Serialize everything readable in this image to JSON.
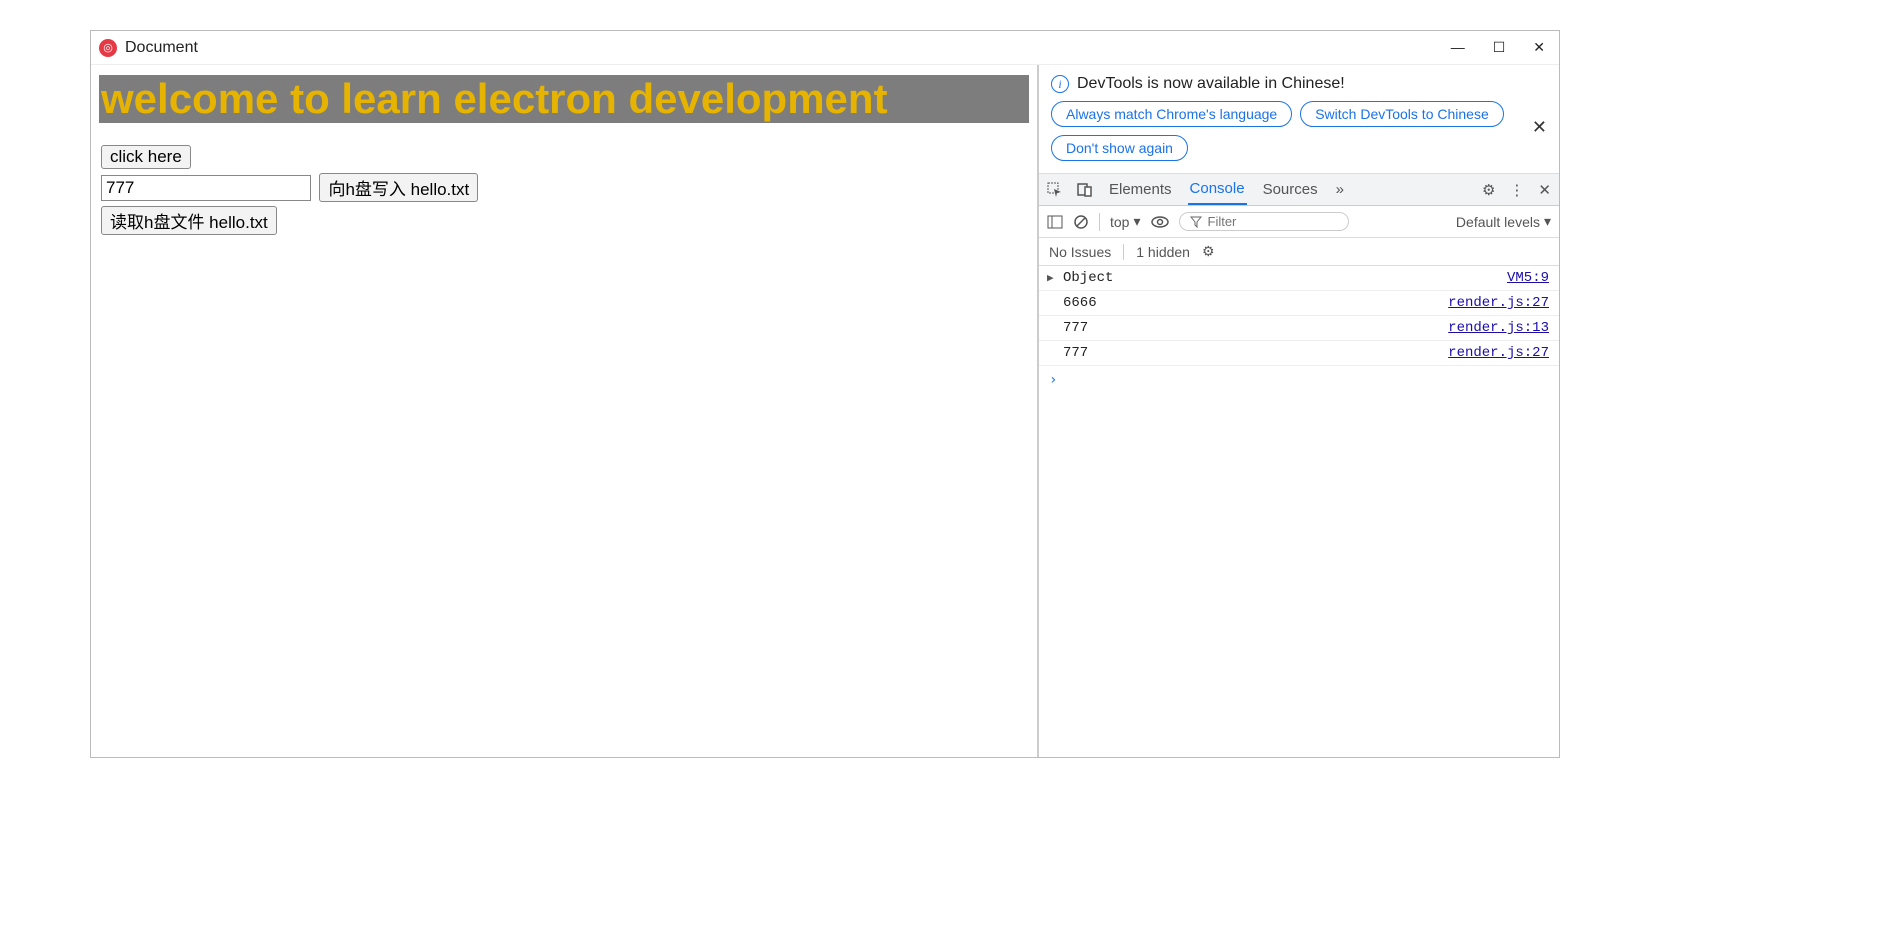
{
  "window": {
    "title": "Document"
  },
  "app": {
    "heading": "welcome to learn electron development",
    "click_button": "click here",
    "input_value": "777",
    "write_button": "向h盘写入 hello.txt",
    "read_button": "读取h盘文件 hello.txt"
  },
  "devtools": {
    "banner": {
      "message": "DevTools is now available in Chinese!",
      "btn_match": "Always match Chrome's language",
      "btn_switch": "Switch DevTools to Chinese",
      "btn_dont": "Don't show again"
    },
    "tabs": {
      "elements": "Elements",
      "console": "Console",
      "sources": "Sources",
      "more": "»"
    },
    "toolbar": {
      "context": "top",
      "filter_placeholder": "Filter",
      "levels": "Default levels"
    },
    "issues": {
      "no_issues": "No Issues",
      "hidden": "1 hidden"
    },
    "logs": [
      {
        "msg": "Object",
        "src": "VM5:9",
        "expandable": true
      },
      {
        "msg": "6666",
        "src": "render.js:27",
        "expandable": false
      },
      {
        "msg": "777",
        "src": "render.js:13",
        "expandable": false
      },
      {
        "msg": "777",
        "src": "render.js:27",
        "expandable": false
      }
    ],
    "prompt": "›"
  }
}
